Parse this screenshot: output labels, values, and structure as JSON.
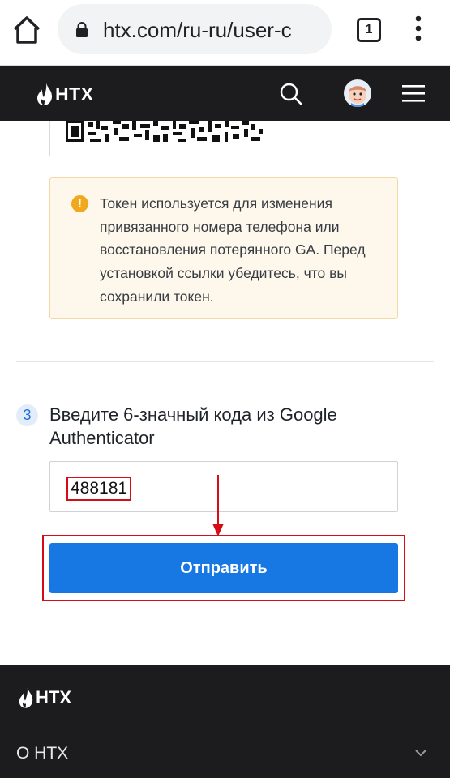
{
  "browser": {
    "url": "htx.com/ru-ru/user-c",
    "tab_count": "1",
    "icons": [
      "home-icon",
      "lock-icon",
      "tabs-icon",
      "menu-dots-icon"
    ]
  },
  "header": {
    "logo_text": "HTX",
    "icons": [
      "htx-flame-icon",
      "search-icon",
      "avatar",
      "hamburger-icon"
    ]
  },
  "warning": {
    "icon": "warning-icon",
    "text": "Токен используется для изменения привязанного номера телефона или восстановления потерянного GA. Перед установкой ссылки убедитесь, что вы сохранили токен."
  },
  "step3": {
    "number": "3",
    "title": "Введите 6-значный кода из Google Authenticator"
  },
  "code_input": {
    "value": "488181"
  },
  "submit": {
    "label": "Отправить"
  },
  "footer": {
    "logo_text": "HTX",
    "about_label": "О HTX",
    "icons": [
      "chevron-down-icon"
    ]
  },
  "colors": {
    "header_bg": "#1c1c1e",
    "primary_blue": "#1778e4",
    "annotation_red": "#d40d16",
    "warning_bg": "#fdf7ec",
    "warning_icon": "#f0a81d"
  }
}
